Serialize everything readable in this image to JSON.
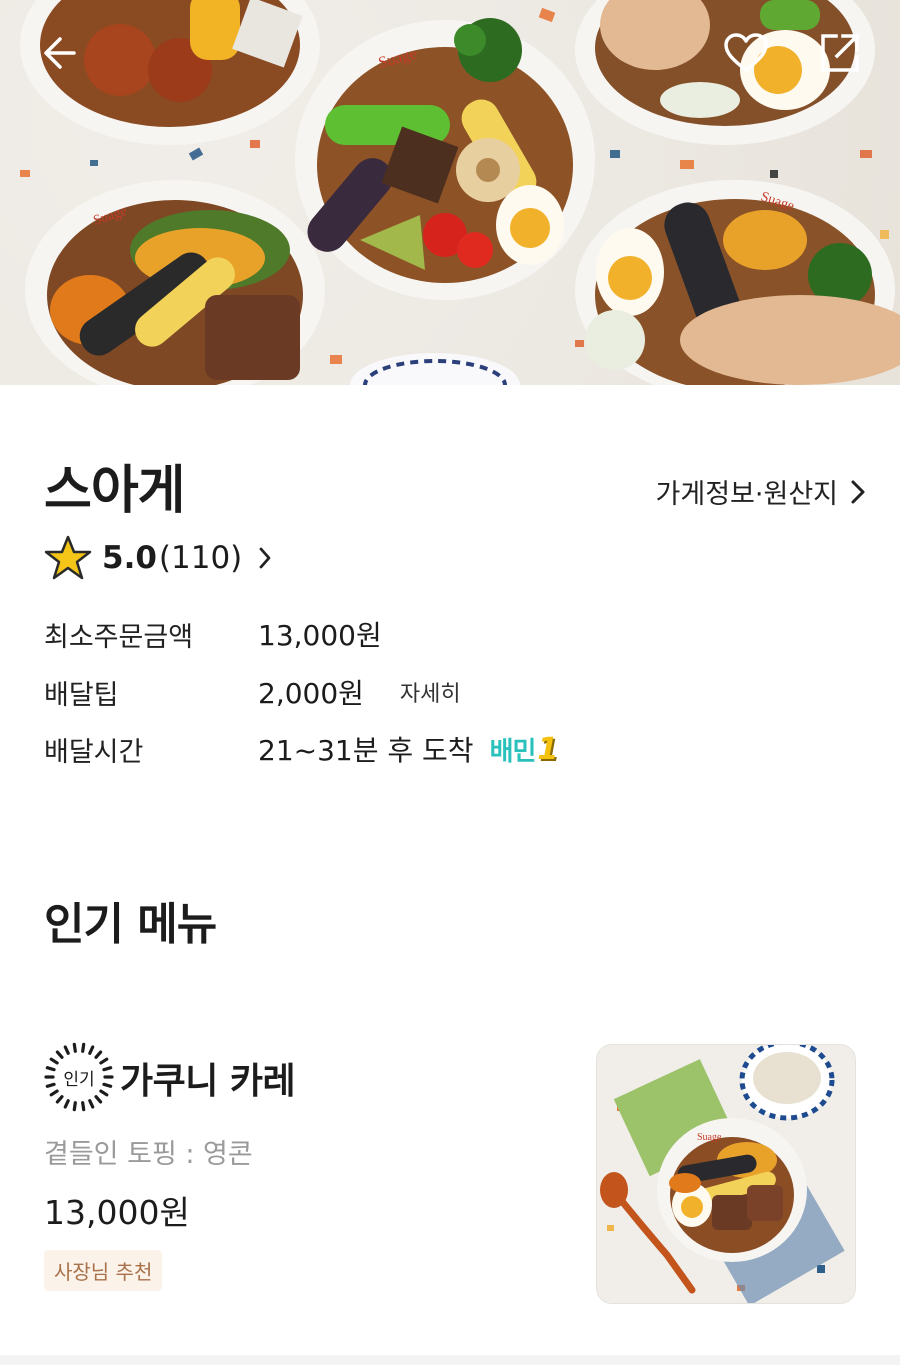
{
  "hero": {
    "back_icon": "arrow-left-icon",
    "favorite_icon": "heart-outline-icon",
    "share_icon": "share-square-icon",
    "bowl_brand": "Suage"
  },
  "store": {
    "name": "스아게",
    "info_link": "가게정보·원산지",
    "rating": "5.0",
    "review_count": "(110)",
    "min_order_label": "최소주문금액",
    "min_order_value": "13,000원",
    "tip_label": "배달팁",
    "tip_value": "2,000원",
    "tip_detail": "자세히",
    "time_label": "배달시간",
    "time_value": "21~31분 후 도착",
    "badge_text": "배민",
    "badge_number": "1"
  },
  "popular_menu": {
    "title": "인기 메뉴",
    "items": [
      {
        "tag": "인기",
        "name": "가쿠니 카레",
        "description": "곁들인 토핑 : 영콘",
        "price": "13,000원",
        "badge": "사장님 추천"
      }
    ]
  },
  "colors": {
    "accent": "#2ac1bc",
    "badge_bg": "#fbf3ea",
    "badge_text": "#a9714a",
    "muted_text": "#9a9a9a"
  }
}
